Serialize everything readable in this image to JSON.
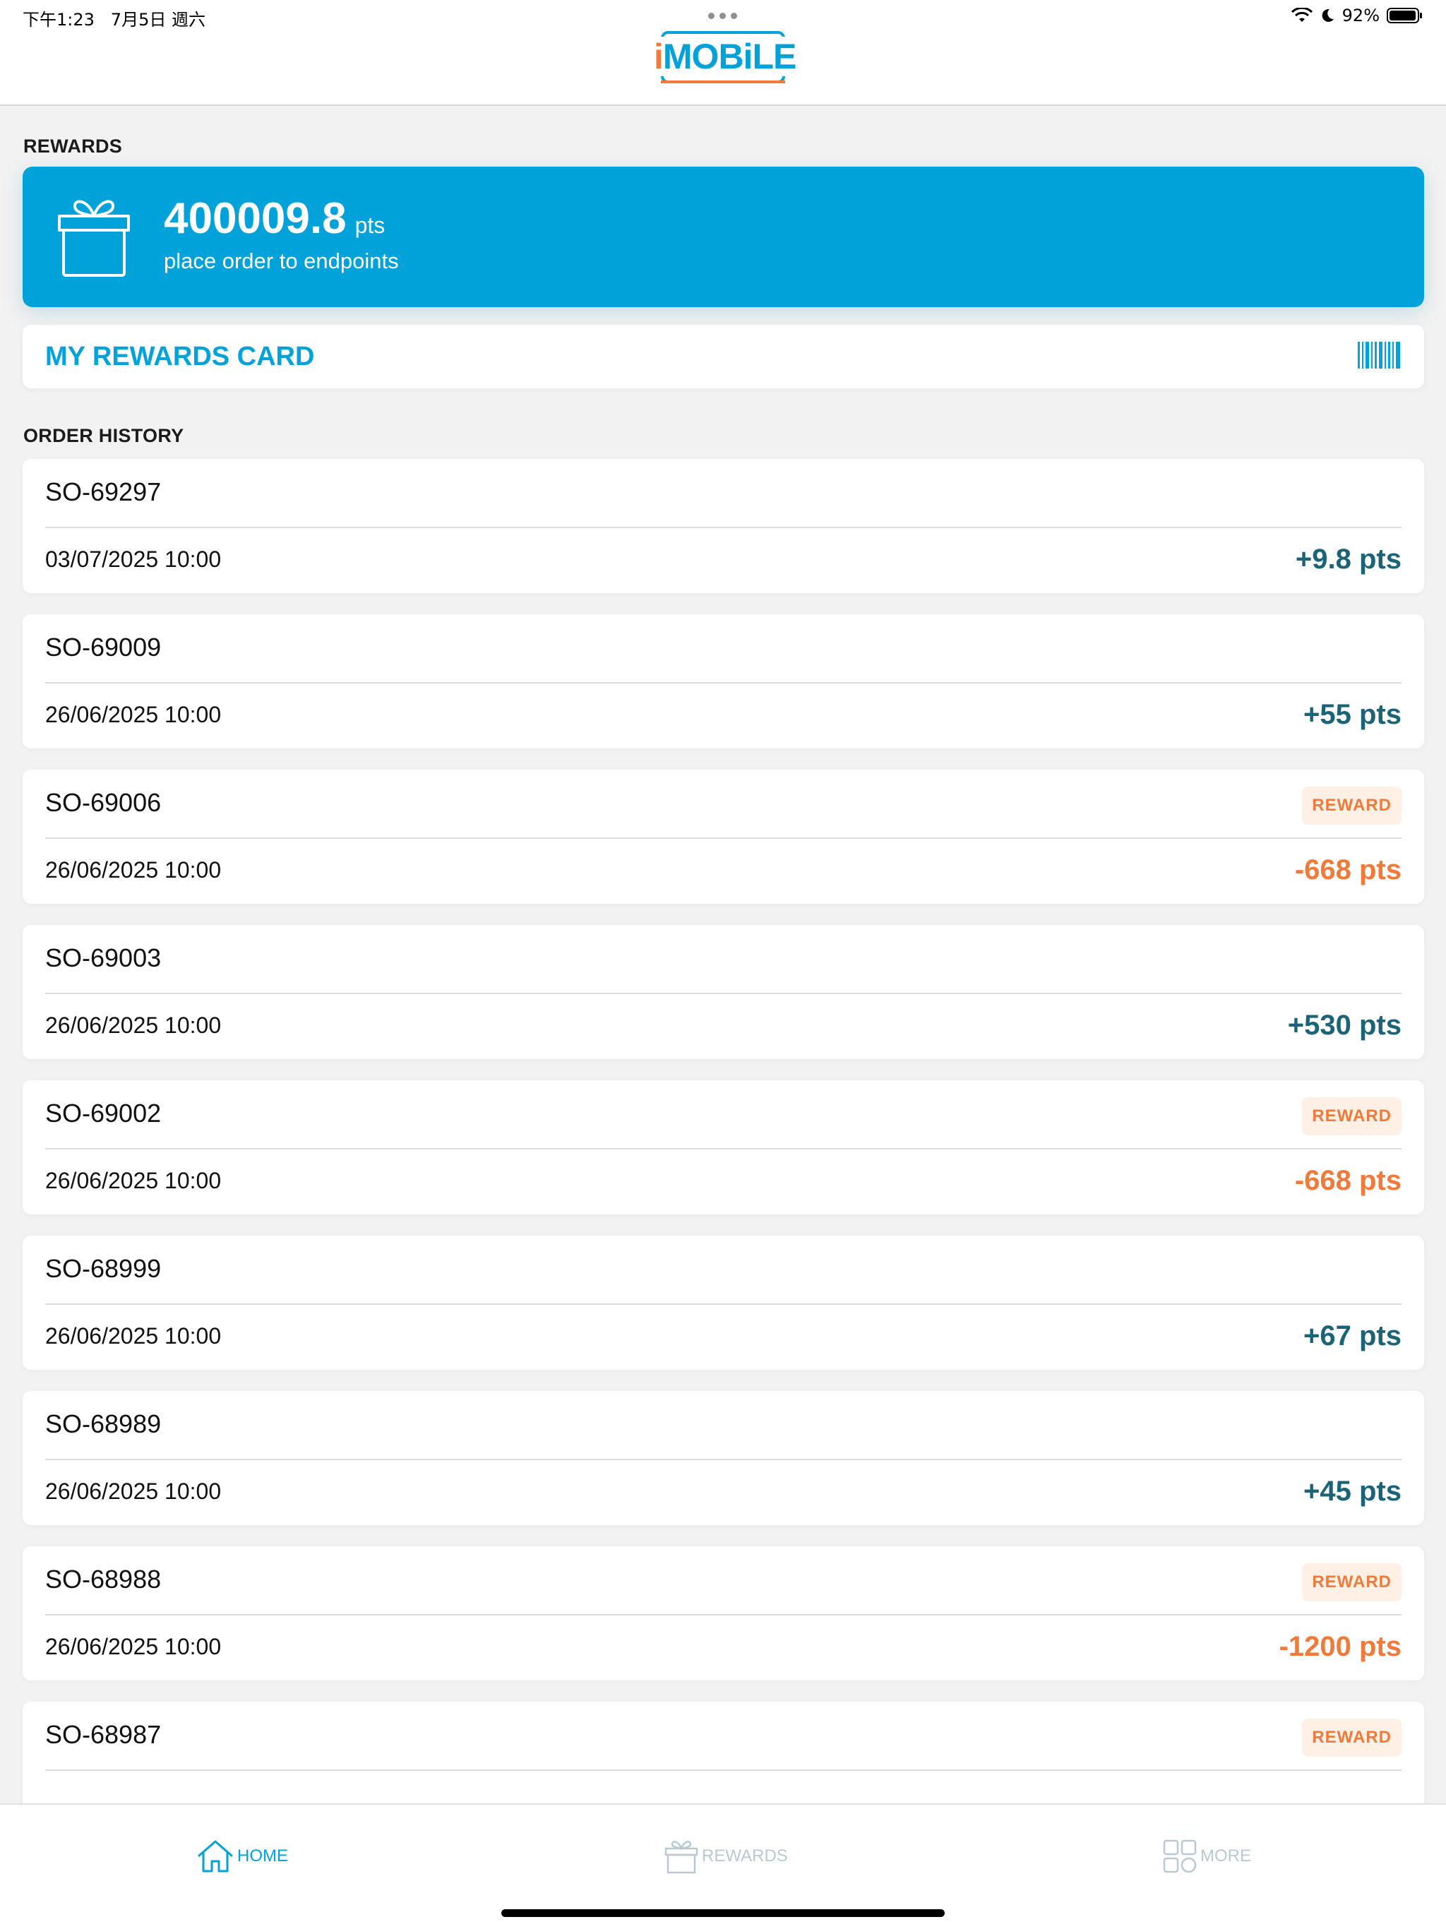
{
  "status_bar": {
    "time": "下午1:23",
    "date": "7月5日 週六",
    "battery": "92%"
  },
  "app": {
    "logo_prefix": "i",
    "logo_rest": "MOBiLE"
  },
  "rewards": {
    "section_label": "REWARDS",
    "points": "400009.8",
    "unit": "pts",
    "subtitle": "place order to endpoints"
  },
  "rewards_card": {
    "label": "MY REWARDS CARD"
  },
  "order_history": {
    "section_label": "ORDER HISTORY",
    "orders": [
      {
        "id": "SO-69297",
        "date": "03/07/2025 10:00",
        "points": "+9.8 pts",
        "type": "pos",
        "badge": ""
      },
      {
        "id": "SO-69009",
        "date": "26/06/2025 10:00",
        "points": "+55 pts",
        "type": "pos",
        "badge": ""
      },
      {
        "id": "SO-69006",
        "date": "26/06/2025 10:00",
        "points": "-668 pts",
        "type": "neg",
        "badge": "REWARD"
      },
      {
        "id": "SO-69003",
        "date": "26/06/2025 10:00",
        "points": "+530 pts",
        "type": "pos",
        "badge": ""
      },
      {
        "id": "SO-69002",
        "date": "26/06/2025 10:00",
        "points": "-668 pts",
        "type": "neg",
        "badge": "REWARD"
      },
      {
        "id": "SO-68999",
        "date": "26/06/2025 10:00",
        "points": "+67 pts",
        "type": "pos",
        "badge": ""
      },
      {
        "id": "SO-68989",
        "date": "26/06/2025 10:00",
        "points": "+45 pts",
        "type": "pos",
        "badge": ""
      },
      {
        "id": "SO-68988",
        "date": "26/06/2025 10:00",
        "points": "-1200 pts",
        "type": "neg",
        "badge": "REWARD"
      },
      {
        "id": "SO-68987",
        "date": "",
        "points": "",
        "type": "neg",
        "badge": "REWARD"
      }
    ]
  },
  "tabbar": {
    "home": "HOME",
    "rewards": "REWARDS",
    "more": "MORE"
  },
  "colors": {
    "brand": "#00a2d9",
    "positive": "#1b6477",
    "negative": "#f07a3a"
  },
  "icons": [
    "gift-icon",
    "barcode-icon",
    "home-icon",
    "gift-tab-icon",
    "grid-icon",
    "wifi-icon",
    "moon-icon",
    "battery-icon"
  ]
}
